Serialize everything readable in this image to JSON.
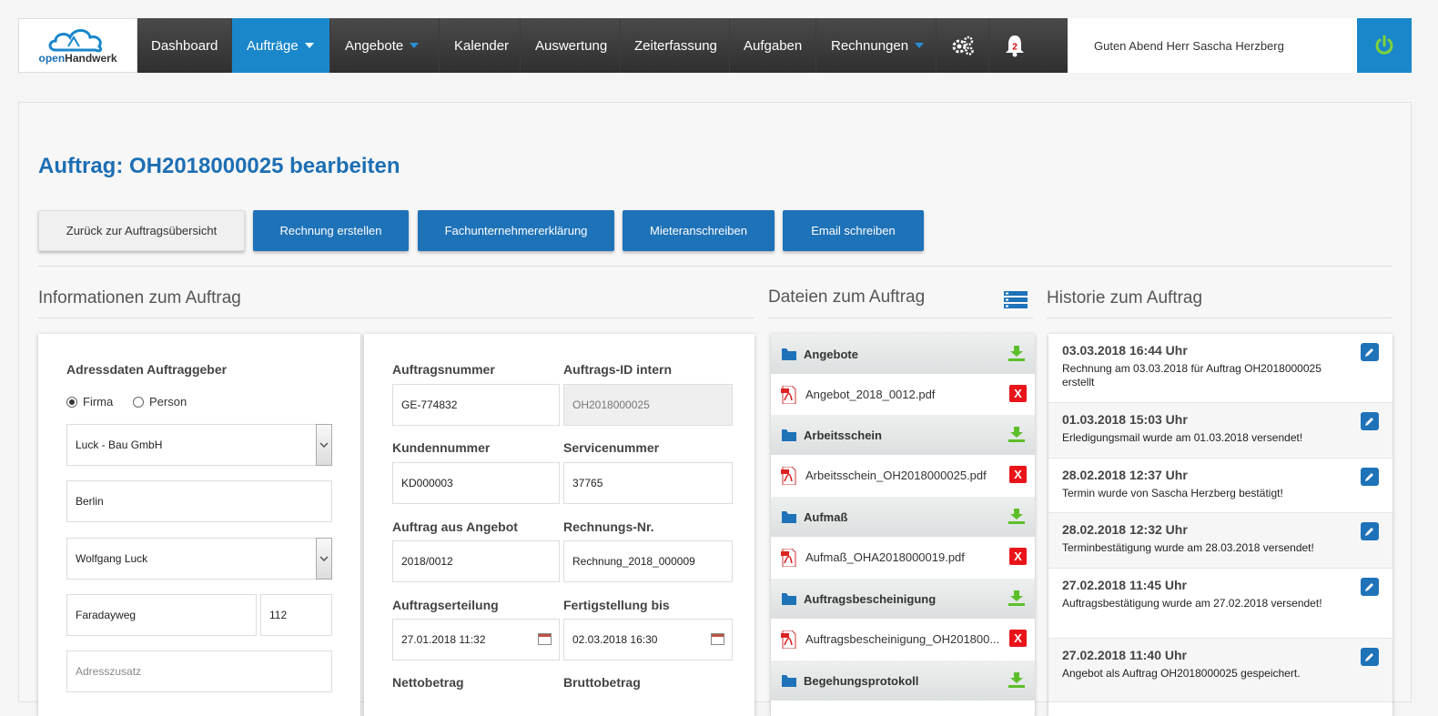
{
  "logo": {
    "text_a": "open",
    "text_b": "Handwerk"
  },
  "nav": {
    "items": [
      {
        "label": "Dashboard"
      },
      {
        "label": "Aufträge"
      },
      {
        "label": "Angebote"
      },
      {
        "label": "Kalender"
      },
      {
        "label": "Auswertung"
      },
      {
        "label": "Zeiterfassung"
      },
      {
        "label": "Aufgaben"
      },
      {
        "label": "Rechnungen"
      }
    ],
    "notification_count": "2",
    "greeting": "Guten Abend Herr Sascha Herzberg"
  },
  "page": {
    "title": "Auftrag: OH2018000025 bearbeiten",
    "buttons": {
      "back": "Zurück zur Auftragsübersicht",
      "invoice": "Rechnung erstellen",
      "subcontractor": "Fachunternehmererklärung",
      "tenant": "Mieteranschreiben",
      "email": "Email schreiben"
    }
  },
  "info": {
    "heading": "Informationen zum Auftrag",
    "address": {
      "title": "Adressdaten Auftraggeber",
      "radio_firma": "Firma",
      "radio_person": "Person",
      "company": "Luck - Bau GmbH",
      "city": "Berlin",
      "contact": "Wolfgang Luck",
      "street": "Faradayweg",
      "number": "112",
      "addr_extra_placeholder": "Adresszusatz"
    },
    "order": {
      "order_number_label": "Auftragsnummer",
      "order_number": "GE-774832",
      "internal_id_label": "Auftrags-ID intern",
      "internal_id": "OH2018000025",
      "customer_number_label": "Kundennummer",
      "customer_number": "KD000003",
      "service_number_label": "Servicenummer",
      "service_number": "37765",
      "from_offer_label": "Auftrag aus Angebot",
      "from_offer": "2018/0012",
      "invoice_no_label": "Rechnungs-Nr.",
      "invoice_no": "Rechnung_2018_000009",
      "placed_label": "Auftragserteilung",
      "placed": "27.01.2018 11:32",
      "due_label": "Fertigstellung bis",
      "due": "02.03.2018 16:30",
      "net_label": "Nettobetrag",
      "gross_label": "Bruttobetrag"
    }
  },
  "files": {
    "heading": "Dateien zum Auftrag",
    "groups": [
      {
        "folder": "Angebote",
        "file": "Angebot_2018_0012.pdf"
      },
      {
        "folder": "Arbeitsschein",
        "file": "Arbeitsschein_OH2018000025.pdf"
      },
      {
        "folder": "Aufmaß",
        "file": "Aufmaß_OHA2018000019.pdf"
      },
      {
        "folder": "Auftragsbescheinigung",
        "file": "Auftragsbescheinigung_OH201800..."
      },
      {
        "folder": "Begehungsprotokoll"
      }
    ]
  },
  "history": {
    "heading": "Historie zum Auftrag",
    "entries": [
      {
        "when": "03.03.2018 16:44 Uhr",
        "text": "Rechnung am 03.03.2018 für Auftrag OH2018000025 erstellt"
      },
      {
        "when": "01.03.2018 15:03 Uhr",
        "text": "Erledigungsmail wurde am 01.03.2018 versendet!"
      },
      {
        "when": "28.02.2018 12:37 Uhr",
        "text": "Termin wurde von Sascha Herzberg bestätigt!"
      },
      {
        "when": "28.02.2018 12:32 Uhr",
        "text": "Terminbestätigung wurde am 28.03.2018 versendet!"
      },
      {
        "when": "27.02.2018 11:45 Uhr",
        "text": "Auftragsbestätigung wurde am 27.02.2018 versendet!"
      },
      {
        "when": "27.02.2018 11:40 Uhr",
        "text": "Angebot als Auftrag OH2018000025 gespeichert."
      }
    ]
  },
  "colors": {
    "brand": "#1e72b8",
    "nav_active": "#1a87cb",
    "power": "#7fd23a",
    "delete": "#e8141a",
    "download": "#5cbf2a"
  }
}
